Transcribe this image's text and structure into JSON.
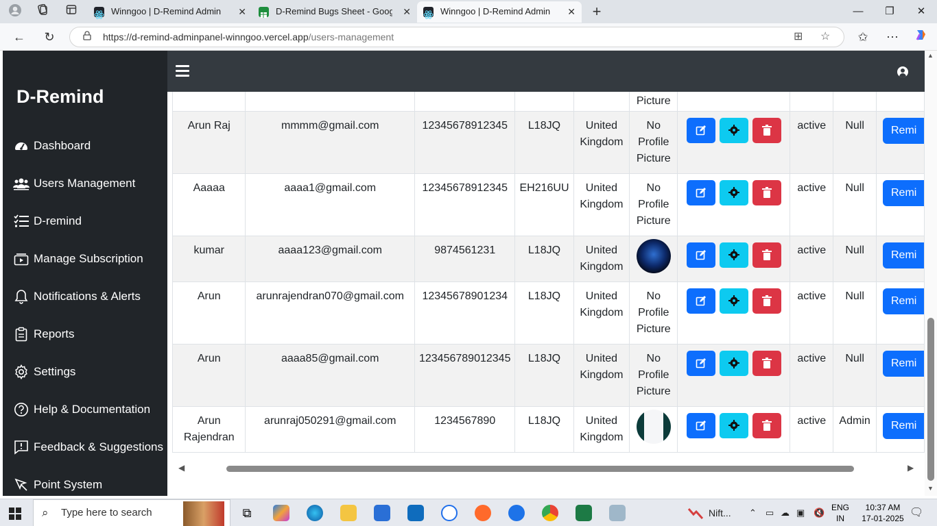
{
  "browser": {
    "tabs": [
      {
        "title": "Winngoo | D-Remind Admin",
        "active": false
      },
      {
        "title": "D-Remind Bugs Sheet - Google Sheets",
        "active": false
      },
      {
        "title": "Winngoo | D-Remind Admin",
        "active": true
      }
    ],
    "url_host": "https://d-remind-adminpanel-winngoo.vercel.app",
    "url_path": "/users-management"
  },
  "sidebar": {
    "brand": "D-Remind",
    "items": [
      {
        "label": "Dashboard",
        "icon": "dashboard-icon"
      },
      {
        "label": "Users Management",
        "icon": "users-icon"
      },
      {
        "label": "D-remind",
        "icon": "list-icon"
      },
      {
        "label": "Manage Subscription",
        "icon": "subscription-icon"
      },
      {
        "label": "Notifications & Alerts",
        "icon": "bell-icon"
      },
      {
        "label": "Reports",
        "icon": "clipboard-icon"
      },
      {
        "label": "Settings",
        "icon": "gear-icon"
      },
      {
        "label": "Help & Documentation",
        "icon": "question-icon"
      },
      {
        "label": "Feedback & Suggestions",
        "icon": "feedback-icon"
      },
      {
        "label": "Point System",
        "icon": "pointer-icon"
      }
    ]
  },
  "table": {
    "partial_row": {
      "picture": "Picture"
    },
    "rows": [
      {
        "name": "Arun Raj",
        "email": "mmmm@gmail.com",
        "phone": "12345678912345",
        "postcode": "L18JQ",
        "country": "United Kingdom",
        "picture": "No Profile Picture",
        "status": "active",
        "role": "Null",
        "remind": "Remi"
      },
      {
        "name": "Aaaaa",
        "email": "aaaa1@gmail.com",
        "phone": "12345678912345",
        "postcode": "EH216UU",
        "country": "United Kingdom",
        "picture": "No Profile Picture",
        "status": "active",
        "role": "Null",
        "remind": "Remi"
      },
      {
        "name": "kumar",
        "email": "aaaa123@gmail.com",
        "phone": "9874561231",
        "postcode": "L18JQ",
        "country": "United Kingdom",
        "picture": "",
        "status": "active",
        "role": "Null",
        "remind": "Remi"
      },
      {
        "name": "Arun",
        "email": "arunrajendran070@gmail.com",
        "phone": "12345678901234",
        "postcode": "L18JQ",
        "country": "United Kingdom",
        "picture": "No Profile Picture",
        "status": "active",
        "role": "Null",
        "remind": "Remi"
      },
      {
        "name": "Arun",
        "email": "aaaa85@gmail.com",
        "phone": "123456789012345",
        "postcode": "L18JQ",
        "country": "United Kingdom",
        "picture": "No Profile Picture",
        "status": "active",
        "role": "Null",
        "remind": "Remi"
      },
      {
        "name": "Arun Rajendran",
        "email": "arunraj050291@gmail.com",
        "phone": "1234567890",
        "postcode": "L18JQ",
        "country": "United Kingdom",
        "picture": "",
        "status": "active",
        "role": "Admin",
        "remind": "Remi"
      }
    ]
  },
  "taskbar": {
    "search_placeholder": "Type here to search",
    "stock_label": "Nift...",
    "lang_top": "ENG",
    "lang_bottom": "IN",
    "time": "10:37 AM",
    "date": "17-01-2025"
  },
  "colors": {
    "primary": "#0d6efd",
    "info": "#0dcaf0",
    "danger": "#dc3545",
    "sidebar": "#212529",
    "header": "#343a40"
  }
}
